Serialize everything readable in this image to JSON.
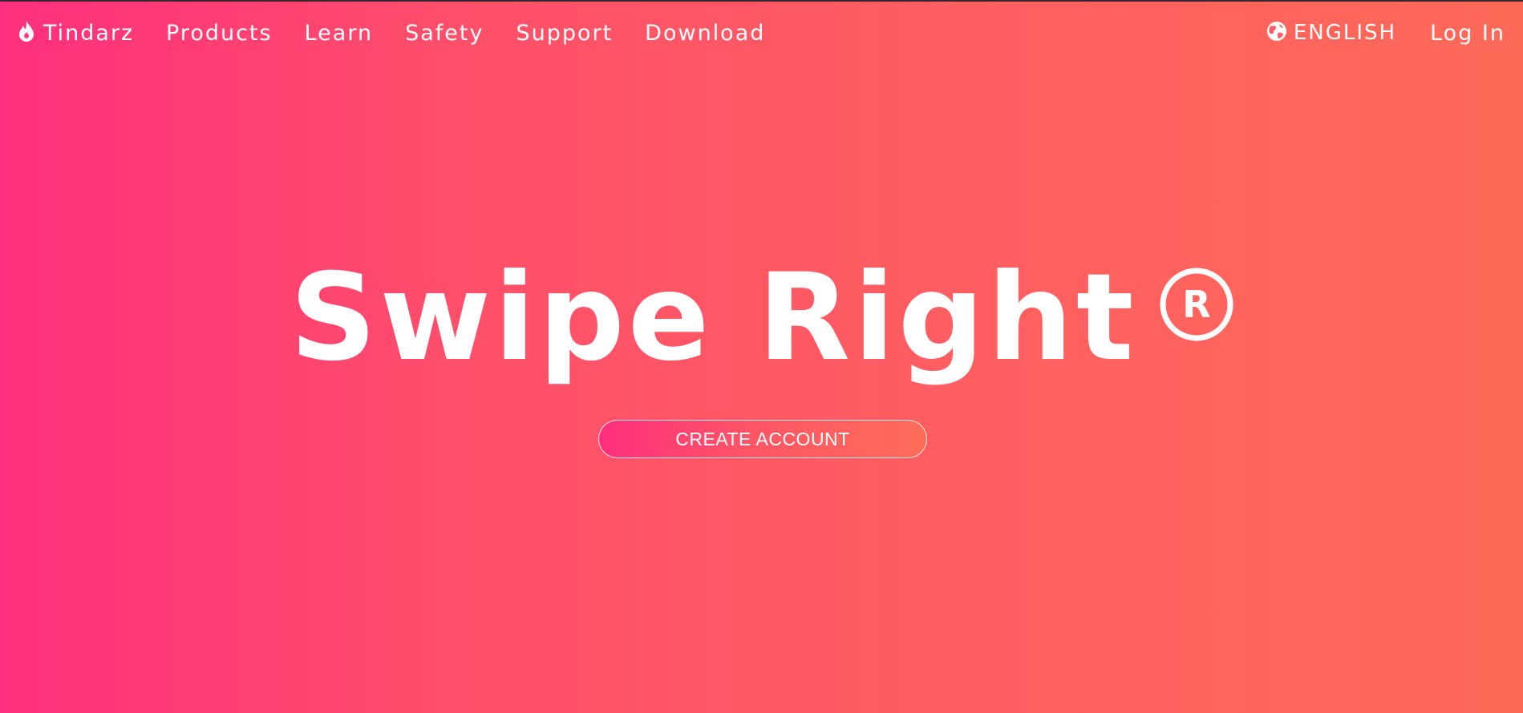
{
  "brand": {
    "name": "Tindarz",
    "icon": "flame-icon"
  },
  "nav": {
    "items": [
      "Products",
      "Learn",
      "Safety",
      "Support",
      "Download"
    ]
  },
  "header_right": {
    "language_icon": "globe-icon",
    "language_label": "ENGLISH",
    "login_label": "Log In"
  },
  "hero": {
    "title": "Swipe Right",
    "registered_mark": "R",
    "cta_label": "CREATE ACCOUNT"
  },
  "colors": {
    "gradient_start": "#ff2f7d",
    "gradient_end": "#ff6a58",
    "text": "#ffffff"
  }
}
